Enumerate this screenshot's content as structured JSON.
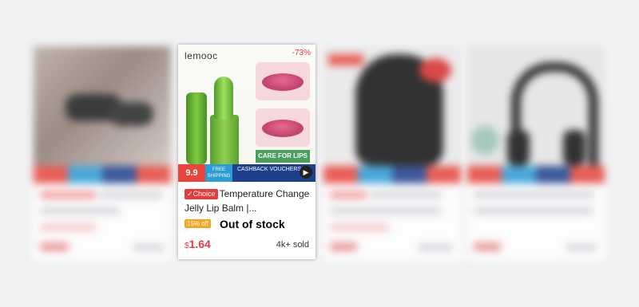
{
  "focused_product": {
    "brand": "lemooc",
    "discount": "-73%",
    "choice_label": "Choice",
    "title": "Temperature Change Jelly Lip Balm |...",
    "off_badge": "15% off",
    "stock_status": "Out of stock",
    "currency": "$",
    "price": "1.64",
    "sold": "4k+ sold",
    "promo": {
      "event": "9.9",
      "shipping": "FREE SHIPPING",
      "cashback": "CASHBACK VOUCHERS"
    },
    "image_caption": "CARE FOR LIPS"
  },
  "colors": {
    "accent_red": "#e83a3a",
    "badge_orange": "#f5a623",
    "care_green": "#48a05a"
  }
}
